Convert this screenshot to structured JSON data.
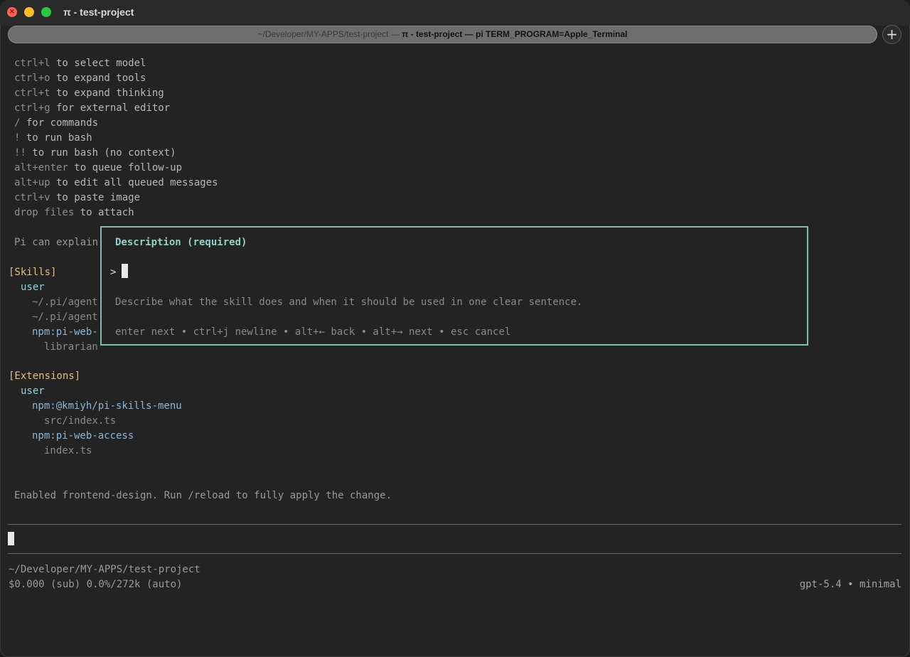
{
  "window": {
    "title": "π - test-project",
    "close_glyph": "×"
  },
  "tab": {
    "path": "~/Developer/MY-APPS/test-project",
    "separator": " — ",
    "name": "π - test-project — pi TERM_PROGRAM=Apple_Terminal",
    "new_tab_label": "+"
  },
  "shortcuts": [
    {
      "key": "ctrl+l",
      "desc": " to select model"
    },
    {
      "key": "ctrl+o",
      "desc": " to expand tools"
    },
    {
      "key": "ctrl+t",
      "desc": " to expand thinking"
    },
    {
      "key": "ctrl+g",
      "desc": " for external editor"
    },
    {
      "key": "/",
      "desc": " for commands"
    },
    {
      "key": "!",
      "desc": " to run bash"
    },
    {
      "key": "!!",
      "desc": " to run bash (no context)"
    },
    {
      "key": "alt+enter",
      "desc": " to queue follow-up"
    },
    {
      "key": "alt+up",
      "desc": " to edit all queued messages"
    },
    {
      "key": "ctrl+v",
      "desc": " to paste image"
    },
    {
      "key": "drop files",
      "desc": " to attach"
    }
  ],
  "explain_line": "Pi can explain",
  "skills": {
    "header": "[Skills]",
    "user": "user",
    "path1": "~/.pi/agent",
    "path2": "~/.pi/agent",
    "pkg": "npm:pi-web-",
    "pkg_sub": "librarian"
  },
  "extensions": {
    "header": "[Extensions]",
    "user": "user",
    "pkg1": "npm:@kmiyh/pi-skills-menu",
    "pkg1_file": "src/index.ts",
    "pkg2": "npm:pi-web-access",
    "pkg2_file": "index.ts"
  },
  "status_message": "Enabled frontend-design. Run /reload to fully apply the change.",
  "modal": {
    "title": "Description (required)",
    "prompt": ">",
    "hint": "Describe what the skill does and when it should be used in one clear sentence.",
    "controls": "enter next • ctrl+j newline • alt+← back • alt+→ next • esc cancel"
  },
  "footer": {
    "cwd": "~/Developer/MY-APPS/test-project",
    "usage": "$0.000 (sub) 0.0%/272k (auto)",
    "model": "gpt-5.4 • minimal"
  },
  "colors": {
    "accent_border": "#7fbcb6",
    "yellow": "#e5c07b",
    "cyan": "#8fd3d8",
    "blue": "#8db6d9"
  }
}
